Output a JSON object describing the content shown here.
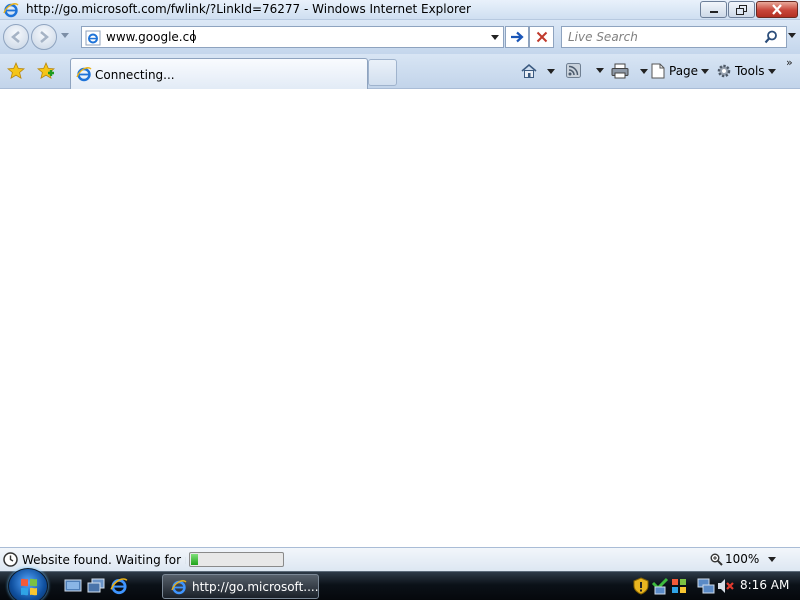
{
  "window": {
    "title": "http://go.microsoft.com/fwlink/?LinkId=76277 - Windows Internet Explorer",
    "title_icon": "ie-logo-icon",
    "buttons": [
      "minimize-icon",
      "restore-icon",
      "close-icon"
    ]
  },
  "address_bar": {
    "url": "www.google.co",
    "site_icon": "ie-page-icon",
    "go_icon": "arrow-right-icon",
    "stop_icon": "x-icon"
  },
  "search": {
    "placeholder": "Live Search",
    "icon": "magnifier-icon"
  },
  "tabs": [
    {
      "label": "Connecting...",
      "icon": "ie-page-icon",
      "active": true
    }
  ],
  "commands": {
    "page_label": "Page",
    "tools_label": "Tools",
    "icons": [
      "home-icon",
      "rss-feed-icon",
      "printer-icon",
      "page-icon",
      "gear-icon",
      "chevron-double-right-icon"
    ]
  },
  "status_bar": {
    "text": "Website found. Waiting for rep",
    "progress": 0.07,
    "zoom": "100%"
  },
  "taskbar": {
    "task_label": "http://go.microsoft....",
    "time": "8:16 AM",
    "quick_launch_icons": [
      "show-desktop-icon",
      "switch-windows-icon",
      "ie-icon"
    ],
    "tray_icons": [
      "shield-alert-icon",
      "network-safety-icon",
      "windows-flag-icon",
      "network-disconnected-icon",
      "speaker-muted-icon"
    ]
  },
  "colors": {
    "chrome": "#c4d6ec",
    "taskbar": "#0b1118",
    "progress": "#1fa31a",
    "stop": "#c0392b",
    "go": "#1a56b8"
  }
}
